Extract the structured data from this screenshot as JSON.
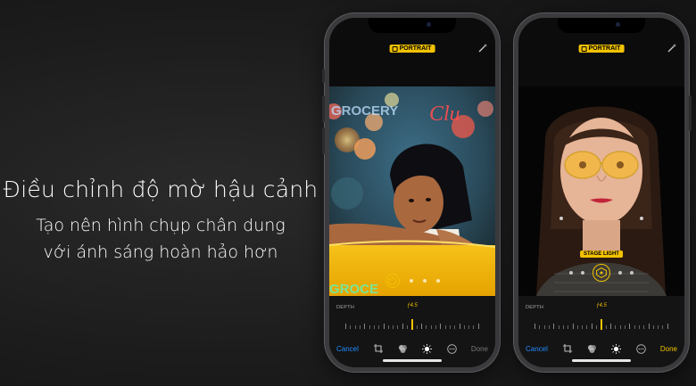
{
  "headline": {
    "title": "Điều chỉnh độ mờ hậu cảnh",
    "line1": "Tạo nên hình chụp chân dung",
    "line2": "với ánh sáng hoàn hảo hơn"
  },
  "phone_left": {
    "mode_badge": "PORTRAIT",
    "photo_sign_top": "GROCERY",
    "photo_sign_right": "Clu",
    "photo_sign_bottom": "GROCE",
    "depth_label": "DEPTH",
    "aperture": "ƒ4.5",
    "cancel_label": "Cancel",
    "done_label": "Done"
  },
  "phone_right": {
    "mode_badge": "PORTRAIT",
    "lighting_label": "STAGE LIGHT",
    "depth_label": "DEPTH",
    "aperture": "ƒ4.5",
    "cancel_label": "Cancel",
    "done_label": "Done"
  },
  "colors": {
    "accent_yellow": "#f2c200",
    "link_blue": "#1f8cff",
    "background": "#1c1c1c"
  },
  "icons": [
    "portrait-cube-icon",
    "magic-wand-icon",
    "crop-rotate-icon",
    "filters-icon",
    "adjust-light-icon",
    "more-icon"
  ]
}
